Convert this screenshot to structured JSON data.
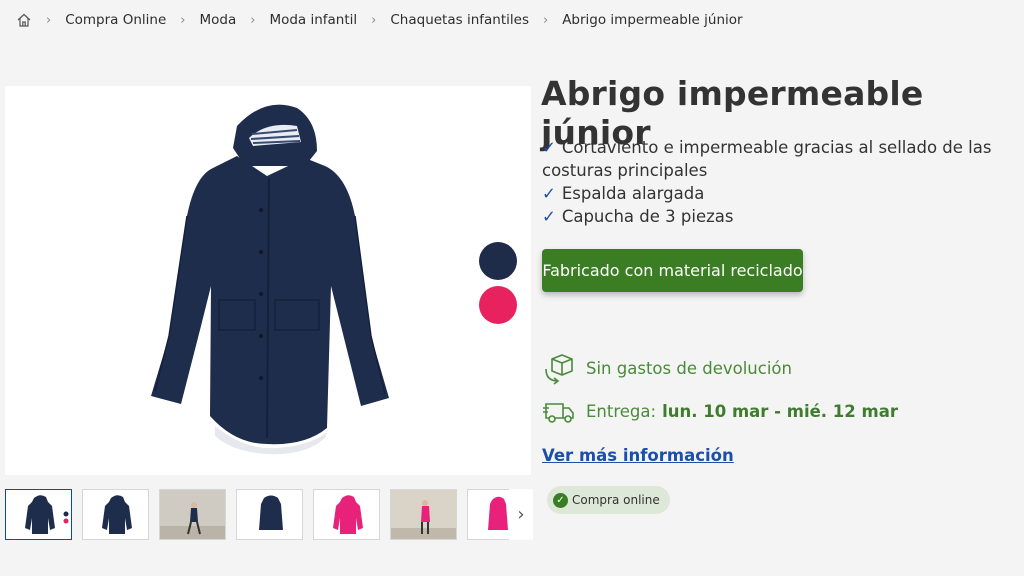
{
  "breadcrumb": {
    "items": [
      "Compra Online",
      "Moda",
      "Moda infantil",
      "Chaquetas infantiles",
      "Abrigo impermeable júnior"
    ]
  },
  "product": {
    "title": "Abrigo impermeable júnior",
    "features": [
      "Cortaviento e impermeable gracias al sellado de las costuras principales",
      "Espalda alargada",
      "Capucha de 3 piezas"
    ],
    "check_glyph": "✓",
    "recycled_label": "Fabricado con material reciclado",
    "return_text": "Sin gastos de devolución",
    "delivery_label": "Entrega:",
    "delivery_date": "lun. 10 mar - mié. 12 mar",
    "more_info_label": "Ver más información",
    "online_badge": "Compra online"
  },
  "colors": {
    "accent_blue": "#1e4eaa",
    "green": "#3b7d23",
    "navy_swatch": "#1e2c49",
    "pink_swatch": "#e8225f"
  },
  "swatches": [
    "navy",
    "pink"
  ],
  "icons": {
    "home": "home-icon",
    "return": "box-return-icon",
    "delivery": "delivery-truck-icon",
    "check": "check-circle-icon",
    "next": "chevron-right-icon"
  }
}
